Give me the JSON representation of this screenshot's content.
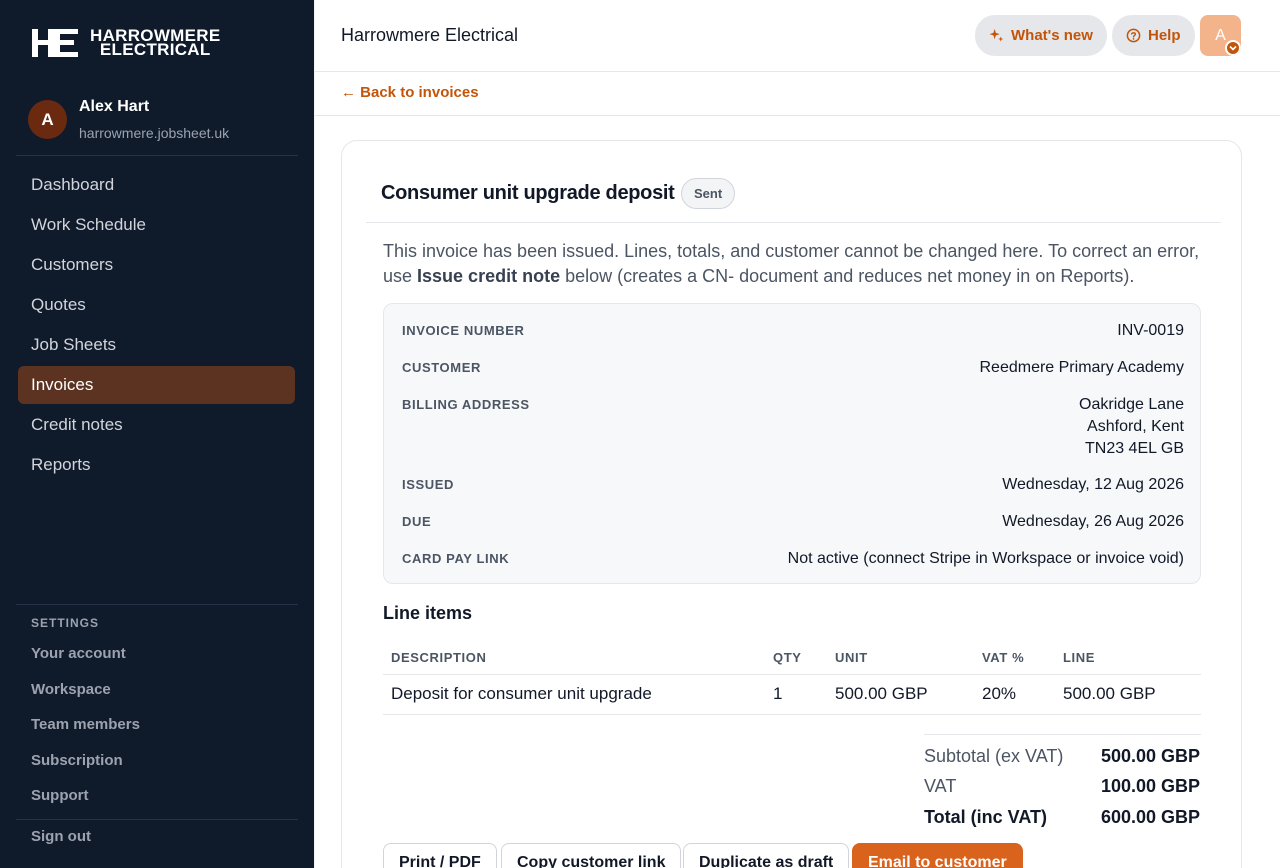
{
  "brand": {
    "line1": "HARROWMERE",
    "line2": "ELECTRICAL"
  },
  "user": {
    "initial": "A",
    "name": "Alex Hart",
    "domain": "harrowmere.jobsheet.uk"
  },
  "nav": [
    {
      "label": "Dashboard"
    },
    {
      "label": "Work Schedule"
    },
    {
      "label": "Customers"
    },
    {
      "label": "Quotes"
    },
    {
      "label": "Job Sheets"
    },
    {
      "label": "Invoices"
    },
    {
      "label": "Credit notes"
    },
    {
      "label": "Reports"
    }
  ],
  "settings": {
    "heading": "SETTINGS",
    "items": [
      {
        "label": "Your account"
      },
      {
        "label": "Workspace"
      },
      {
        "label": "Team members"
      },
      {
        "label": "Subscription"
      },
      {
        "label": "Support"
      }
    ],
    "sign_out": "Sign out"
  },
  "topbar": {
    "title": "Harrowmere Electrical",
    "whats_new": "What's new",
    "help": "Help",
    "avatar_initial": "A"
  },
  "back_link": "← Back to invoices",
  "invoice": {
    "title": "Consumer unit upgrade deposit",
    "status": "Sent",
    "notice_1": "This invoice has been issued. Lines, totals, and customer cannot be changed here. To correct an error, use ",
    "notice_bold": "Issue credit note",
    "notice_2": " below (creates a CN- document and reduces net money in on Reports).",
    "details": {
      "number_label": "INVOICE NUMBER",
      "number": "INV-0019",
      "customer_label": "CUSTOMER",
      "customer": "Reedmere Primary Academy",
      "address_label": "BILLING ADDRESS",
      "address_1": "Oakridge Lane",
      "address_2": "Ashford, Kent",
      "address_3": "TN23 4EL GB",
      "issued_label": "ISSUED",
      "issued": "Wednesday, 12 Aug 2026",
      "due_label": "DUE",
      "due": "Wednesday, 26 Aug 2026",
      "card_label": "CARD PAY LINK",
      "card": "Not active (connect Stripe in Workspace or invoice void)"
    },
    "line_items": {
      "title": "Line items",
      "headers": {
        "description": "DESCRIPTION",
        "qty": "QTY",
        "unit": "UNIT",
        "vat": "VAT %",
        "line": "LINE"
      },
      "rows": [
        {
          "description": "Deposit for consumer unit upgrade",
          "qty": "1",
          "unit": "500.00 GBP",
          "vat": "20%",
          "line": "500.00 GBP"
        }
      ]
    },
    "totals": {
      "subtotal_label": "Subtotal (ex VAT)",
      "subtotal": "500.00 GBP",
      "vat_label": "VAT",
      "vat": "100.00 GBP",
      "total_label": "Total (inc VAT)",
      "total": "600.00 GBP"
    },
    "actions": {
      "print": "Print / PDF",
      "copy": "Copy customer link",
      "duplicate": "Duplicate as draft",
      "email": "Email to customer"
    }
  },
  "colors": {
    "sidebar": "#0f1a2b",
    "accent": "#c2550a",
    "active_nav": "#5b3320",
    "primary_button": "#d9621c"
  }
}
